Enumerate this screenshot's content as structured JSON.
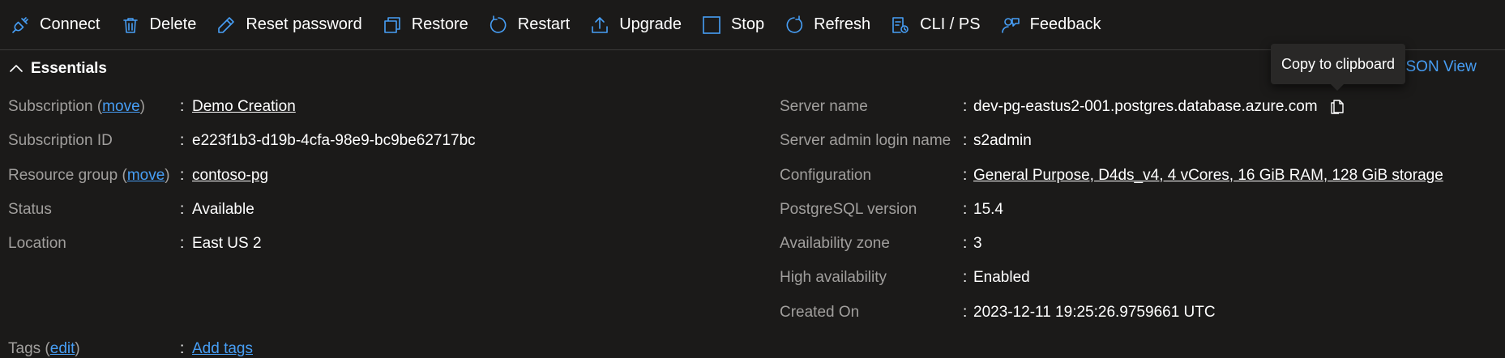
{
  "toolbar": {
    "items": [
      {
        "label": "Connect",
        "icon": "plug-icon"
      },
      {
        "label": "Delete",
        "icon": "trash-icon"
      },
      {
        "label": "Reset password",
        "icon": "pencil-icon"
      },
      {
        "label": "Restore",
        "icon": "restore-icon"
      },
      {
        "label": "Restart",
        "icon": "restart-icon"
      },
      {
        "label": "Upgrade",
        "icon": "upload-icon"
      },
      {
        "label": "Stop",
        "icon": "stop-icon"
      },
      {
        "label": "Refresh",
        "icon": "refresh-icon"
      },
      {
        "label": "CLI / PS",
        "icon": "cli-icon"
      },
      {
        "label": "Feedback",
        "icon": "feedback-icon"
      }
    ]
  },
  "essentials": {
    "title": "Essentials",
    "json_view": "JSON View",
    "tooltip": "Copy to clipboard",
    "left": {
      "subscription_label": "Subscription",
      "move_link": "move",
      "subscription_value": "Demo Creation",
      "subscription_id_label": "Subscription ID",
      "subscription_id_value": "e223f1b3-d19b-4cfa-98e9-bc9be62717bc",
      "resource_group_label": "Resource group",
      "resource_group_value": "contoso-pg",
      "status_label": "Status",
      "status_value": "Available",
      "location_label": "Location",
      "location_value": "East US 2"
    },
    "right": {
      "server_name_label": "Server name",
      "server_name_value": "dev-pg-eastus2-001.postgres.database.azure.com",
      "admin_label": "Server admin login name",
      "admin_value": "s2admin",
      "config_label": "Configuration",
      "config_value": "General Purpose, D4ds_v4, 4 vCores, 16 GiB RAM, 128 GiB storage",
      "version_label": "PostgreSQL version",
      "version_value": "15.4",
      "zone_label": "Availability zone",
      "zone_value": "3",
      "ha_label": "High availability",
      "ha_value": "Enabled",
      "created_label": "Created On",
      "created_value": "2023-12-11 19:25:26.9759661 UTC"
    },
    "tags": {
      "label": "Tags",
      "edit_link": "edit",
      "value": "Add tags"
    },
    "separator": ":"
  },
  "colors": {
    "background": "#1b1a19",
    "accent_icon": "#479ef5",
    "label_gray": "#a19f9d",
    "link": "#479ef5"
  }
}
